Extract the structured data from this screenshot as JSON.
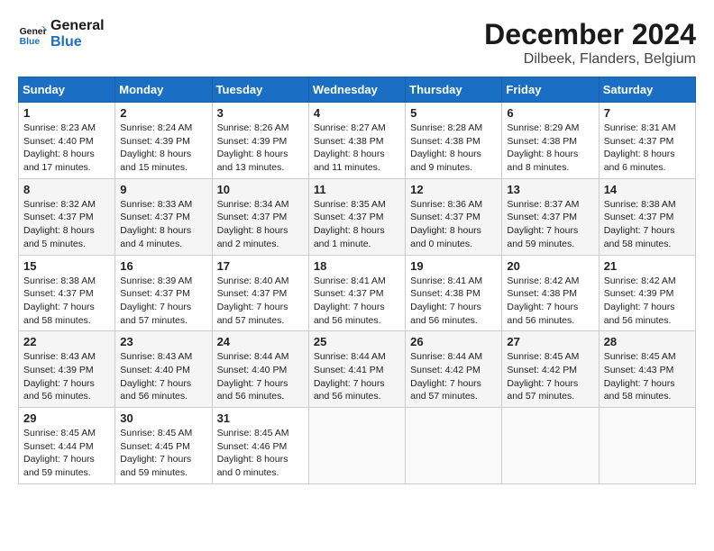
{
  "logo": {
    "line1": "General",
    "line2": "Blue"
  },
  "title": "December 2024",
  "subtitle": "Dilbeek, Flanders, Belgium",
  "days_header": [
    "Sunday",
    "Monday",
    "Tuesday",
    "Wednesday",
    "Thursday",
    "Friday",
    "Saturday"
  ],
  "weeks": [
    [
      {
        "day": "1",
        "sunrise": "8:23 AM",
        "sunset": "4:40 PM",
        "daylight": "8 hours and 17 minutes."
      },
      {
        "day": "2",
        "sunrise": "8:24 AM",
        "sunset": "4:39 PM",
        "daylight": "8 hours and 15 minutes."
      },
      {
        "day": "3",
        "sunrise": "8:26 AM",
        "sunset": "4:39 PM",
        "daylight": "8 hours and 13 minutes."
      },
      {
        "day": "4",
        "sunrise": "8:27 AM",
        "sunset": "4:38 PM",
        "daylight": "8 hours and 11 minutes."
      },
      {
        "day": "5",
        "sunrise": "8:28 AM",
        "sunset": "4:38 PM",
        "daylight": "8 hours and 9 minutes."
      },
      {
        "day": "6",
        "sunrise": "8:29 AM",
        "sunset": "4:38 PM",
        "daylight": "8 hours and 8 minutes."
      },
      {
        "day": "7",
        "sunrise": "8:31 AM",
        "sunset": "4:37 PM",
        "daylight": "8 hours and 6 minutes."
      }
    ],
    [
      {
        "day": "8",
        "sunrise": "8:32 AM",
        "sunset": "4:37 PM",
        "daylight": "8 hours and 5 minutes."
      },
      {
        "day": "9",
        "sunrise": "8:33 AM",
        "sunset": "4:37 PM",
        "daylight": "8 hours and 4 minutes."
      },
      {
        "day": "10",
        "sunrise": "8:34 AM",
        "sunset": "4:37 PM",
        "daylight": "8 hours and 2 minutes."
      },
      {
        "day": "11",
        "sunrise": "8:35 AM",
        "sunset": "4:37 PM",
        "daylight": "8 hours and 1 minute."
      },
      {
        "day": "12",
        "sunrise": "8:36 AM",
        "sunset": "4:37 PM",
        "daylight": "8 hours and 0 minutes."
      },
      {
        "day": "13",
        "sunrise": "8:37 AM",
        "sunset": "4:37 PM",
        "daylight": "7 hours and 59 minutes."
      },
      {
        "day": "14",
        "sunrise": "8:38 AM",
        "sunset": "4:37 PM",
        "daylight": "7 hours and 58 minutes."
      }
    ],
    [
      {
        "day": "15",
        "sunrise": "8:38 AM",
        "sunset": "4:37 PM",
        "daylight": "7 hours and 58 minutes."
      },
      {
        "day": "16",
        "sunrise": "8:39 AM",
        "sunset": "4:37 PM",
        "daylight": "7 hours and 57 minutes."
      },
      {
        "day": "17",
        "sunrise": "8:40 AM",
        "sunset": "4:37 PM",
        "daylight": "7 hours and 57 minutes."
      },
      {
        "day": "18",
        "sunrise": "8:41 AM",
        "sunset": "4:37 PM",
        "daylight": "7 hours and 56 minutes."
      },
      {
        "day": "19",
        "sunrise": "8:41 AM",
        "sunset": "4:38 PM",
        "daylight": "7 hours and 56 minutes."
      },
      {
        "day": "20",
        "sunrise": "8:42 AM",
        "sunset": "4:38 PM",
        "daylight": "7 hours and 56 minutes."
      },
      {
        "day": "21",
        "sunrise": "8:42 AM",
        "sunset": "4:39 PM",
        "daylight": "7 hours and 56 minutes."
      }
    ],
    [
      {
        "day": "22",
        "sunrise": "8:43 AM",
        "sunset": "4:39 PM",
        "daylight": "7 hours and 56 minutes."
      },
      {
        "day": "23",
        "sunrise": "8:43 AM",
        "sunset": "4:40 PM",
        "daylight": "7 hours and 56 minutes."
      },
      {
        "day": "24",
        "sunrise": "8:44 AM",
        "sunset": "4:40 PM",
        "daylight": "7 hours and 56 minutes."
      },
      {
        "day": "25",
        "sunrise": "8:44 AM",
        "sunset": "4:41 PM",
        "daylight": "7 hours and 56 minutes."
      },
      {
        "day": "26",
        "sunrise": "8:44 AM",
        "sunset": "4:42 PM",
        "daylight": "7 hours and 57 minutes."
      },
      {
        "day": "27",
        "sunrise": "8:45 AM",
        "sunset": "4:42 PM",
        "daylight": "7 hours and 57 minutes."
      },
      {
        "day": "28",
        "sunrise": "8:45 AM",
        "sunset": "4:43 PM",
        "daylight": "7 hours and 58 minutes."
      }
    ],
    [
      {
        "day": "29",
        "sunrise": "8:45 AM",
        "sunset": "4:44 PM",
        "daylight": "7 hours and 59 minutes."
      },
      {
        "day": "30",
        "sunrise": "8:45 AM",
        "sunset": "4:45 PM",
        "daylight": "7 hours and 59 minutes."
      },
      {
        "day": "31",
        "sunrise": "8:45 AM",
        "sunset": "4:46 PM",
        "daylight": "8 hours and 0 minutes."
      },
      null,
      null,
      null,
      null
    ]
  ]
}
